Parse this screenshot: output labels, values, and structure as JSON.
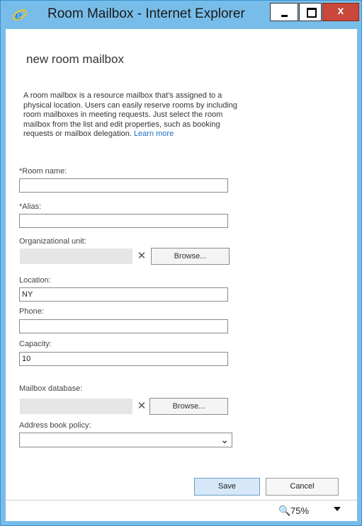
{
  "window": {
    "title": "Room Mailbox - Internet Explorer",
    "close_label": "x",
    "accent_color": "#78bde9"
  },
  "form": {
    "heading": "new room mailbox",
    "description": "A room mailbox is a resource mailbox that's assigned to a physical location. Users can easily reserve rooms by including room mailboxes in meeting requests. Just select the room mailbox from the list and edit properties, such as booking requests or mailbox delegation.",
    "learn_more": "Learn more",
    "room_name": {
      "label": "*Room name:",
      "value": ""
    },
    "alias": {
      "label": "*Alias:",
      "value": ""
    },
    "org_unit": {
      "label": "Organizational unit:",
      "browse_label": "Browse...",
      "clear_label": "✕"
    },
    "location": {
      "label": "Location:",
      "value": "NY"
    },
    "phone": {
      "label": "Phone:",
      "value": ""
    },
    "capacity": {
      "label": "Capacity:",
      "value": "10"
    },
    "mailbox_db": {
      "label": "Mailbox database:",
      "browse_label": "Browse...",
      "clear_label": "✕"
    },
    "address_book_policy": {
      "label": "Address book policy:",
      "value": ""
    },
    "save_label": "Save",
    "cancel_label": "Cancel"
  },
  "statusbar": {
    "zoom": "75%"
  }
}
